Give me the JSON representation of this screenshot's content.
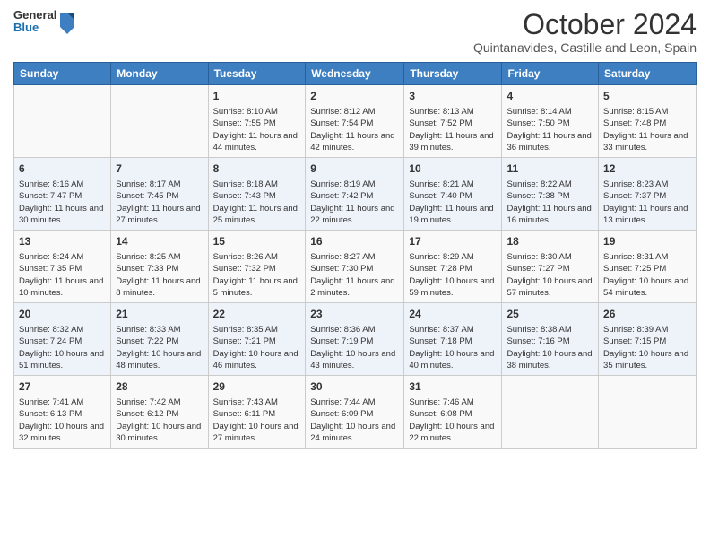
{
  "logo": {
    "general": "General",
    "blue": "Blue"
  },
  "title": "October 2024",
  "subtitle": "Quintanavides, Castille and Leon, Spain",
  "days_of_week": [
    "Sunday",
    "Monday",
    "Tuesday",
    "Wednesday",
    "Thursday",
    "Friday",
    "Saturday"
  ],
  "weeks": [
    [
      {
        "day": "",
        "sunrise": "",
        "sunset": "",
        "daylight": ""
      },
      {
        "day": "",
        "sunrise": "",
        "sunset": "",
        "daylight": ""
      },
      {
        "day": "1",
        "sunrise": "Sunrise: 8:10 AM",
        "sunset": "Sunset: 7:55 PM",
        "daylight": "Daylight: 11 hours and 44 minutes."
      },
      {
        "day": "2",
        "sunrise": "Sunrise: 8:12 AM",
        "sunset": "Sunset: 7:54 PM",
        "daylight": "Daylight: 11 hours and 42 minutes."
      },
      {
        "day": "3",
        "sunrise": "Sunrise: 8:13 AM",
        "sunset": "Sunset: 7:52 PM",
        "daylight": "Daylight: 11 hours and 39 minutes."
      },
      {
        "day": "4",
        "sunrise": "Sunrise: 8:14 AM",
        "sunset": "Sunset: 7:50 PM",
        "daylight": "Daylight: 11 hours and 36 minutes."
      },
      {
        "day": "5",
        "sunrise": "Sunrise: 8:15 AM",
        "sunset": "Sunset: 7:48 PM",
        "daylight": "Daylight: 11 hours and 33 minutes."
      }
    ],
    [
      {
        "day": "6",
        "sunrise": "Sunrise: 8:16 AM",
        "sunset": "Sunset: 7:47 PM",
        "daylight": "Daylight: 11 hours and 30 minutes."
      },
      {
        "day": "7",
        "sunrise": "Sunrise: 8:17 AM",
        "sunset": "Sunset: 7:45 PM",
        "daylight": "Daylight: 11 hours and 27 minutes."
      },
      {
        "day": "8",
        "sunrise": "Sunrise: 8:18 AM",
        "sunset": "Sunset: 7:43 PM",
        "daylight": "Daylight: 11 hours and 25 minutes."
      },
      {
        "day": "9",
        "sunrise": "Sunrise: 8:19 AM",
        "sunset": "Sunset: 7:42 PM",
        "daylight": "Daylight: 11 hours and 22 minutes."
      },
      {
        "day": "10",
        "sunrise": "Sunrise: 8:21 AM",
        "sunset": "Sunset: 7:40 PM",
        "daylight": "Daylight: 11 hours and 19 minutes."
      },
      {
        "day": "11",
        "sunrise": "Sunrise: 8:22 AM",
        "sunset": "Sunset: 7:38 PM",
        "daylight": "Daylight: 11 hours and 16 minutes."
      },
      {
        "day": "12",
        "sunrise": "Sunrise: 8:23 AM",
        "sunset": "Sunset: 7:37 PM",
        "daylight": "Daylight: 11 hours and 13 minutes."
      }
    ],
    [
      {
        "day": "13",
        "sunrise": "Sunrise: 8:24 AM",
        "sunset": "Sunset: 7:35 PM",
        "daylight": "Daylight: 11 hours and 10 minutes."
      },
      {
        "day": "14",
        "sunrise": "Sunrise: 8:25 AM",
        "sunset": "Sunset: 7:33 PM",
        "daylight": "Daylight: 11 hours and 8 minutes."
      },
      {
        "day": "15",
        "sunrise": "Sunrise: 8:26 AM",
        "sunset": "Sunset: 7:32 PM",
        "daylight": "Daylight: 11 hours and 5 minutes."
      },
      {
        "day": "16",
        "sunrise": "Sunrise: 8:27 AM",
        "sunset": "Sunset: 7:30 PM",
        "daylight": "Daylight: 11 hours and 2 minutes."
      },
      {
        "day": "17",
        "sunrise": "Sunrise: 8:29 AM",
        "sunset": "Sunset: 7:28 PM",
        "daylight": "Daylight: 10 hours and 59 minutes."
      },
      {
        "day": "18",
        "sunrise": "Sunrise: 8:30 AM",
        "sunset": "Sunset: 7:27 PM",
        "daylight": "Daylight: 10 hours and 57 minutes."
      },
      {
        "day": "19",
        "sunrise": "Sunrise: 8:31 AM",
        "sunset": "Sunset: 7:25 PM",
        "daylight": "Daylight: 10 hours and 54 minutes."
      }
    ],
    [
      {
        "day": "20",
        "sunrise": "Sunrise: 8:32 AM",
        "sunset": "Sunset: 7:24 PM",
        "daylight": "Daylight: 10 hours and 51 minutes."
      },
      {
        "day": "21",
        "sunrise": "Sunrise: 8:33 AM",
        "sunset": "Sunset: 7:22 PM",
        "daylight": "Daylight: 10 hours and 48 minutes."
      },
      {
        "day": "22",
        "sunrise": "Sunrise: 8:35 AM",
        "sunset": "Sunset: 7:21 PM",
        "daylight": "Daylight: 10 hours and 46 minutes."
      },
      {
        "day": "23",
        "sunrise": "Sunrise: 8:36 AM",
        "sunset": "Sunset: 7:19 PM",
        "daylight": "Daylight: 10 hours and 43 minutes."
      },
      {
        "day": "24",
        "sunrise": "Sunrise: 8:37 AM",
        "sunset": "Sunset: 7:18 PM",
        "daylight": "Daylight: 10 hours and 40 minutes."
      },
      {
        "day": "25",
        "sunrise": "Sunrise: 8:38 AM",
        "sunset": "Sunset: 7:16 PM",
        "daylight": "Daylight: 10 hours and 38 minutes."
      },
      {
        "day": "26",
        "sunrise": "Sunrise: 8:39 AM",
        "sunset": "Sunset: 7:15 PM",
        "daylight": "Daylight: 10 hours and 35 minutes."
      }
    ],
    [
      {
        "day": "27",
        "sunrise": "Sunrise: 7:41 AM",
        "sunset": "Sunset: 6:13 PM",
        "daylight": "Daylight: 10 hours and 32 minutes."
      },
      {
        "day": "28",
        "sunrise": "Sunrise: 7:42 AM",
        "sunset": "Sunset: 6:12 PM",
        "daylight": "Daylight: 10 hours and 30 minutes."
      },
      {
        "day": "29",
        "sunrise": "Sunrise: 7:43 AM",
        "sunset": "Sunset: 6:11 PM",
        "daylight": "Daylight: 10 hours and 27 minutes."
      },
      {
        "day": "30",
        "sunrise": "Sunrise: 7:44 AM",
        "sunset": "Sunset: 6:09 PM",
        "daylight": "Daylight: 10 hours and 24 minutes."
      },
      {
        "day": "31",
        "sunrise": "Sunrise: 7:46 AM",
        "sunset": "Sunset: 6:08 PM",
        "daylight": "Daylight: 10 hours and 22 minutes."
      },
      {
        "day": "",
        "sunrise": "",
        "sunset": "",
        "daylight": ""
      },
      {
        "day": "",
        "sunrise": "",
        "sunset": "",
        "daylight": ""
      }
    ]
  ]
}
